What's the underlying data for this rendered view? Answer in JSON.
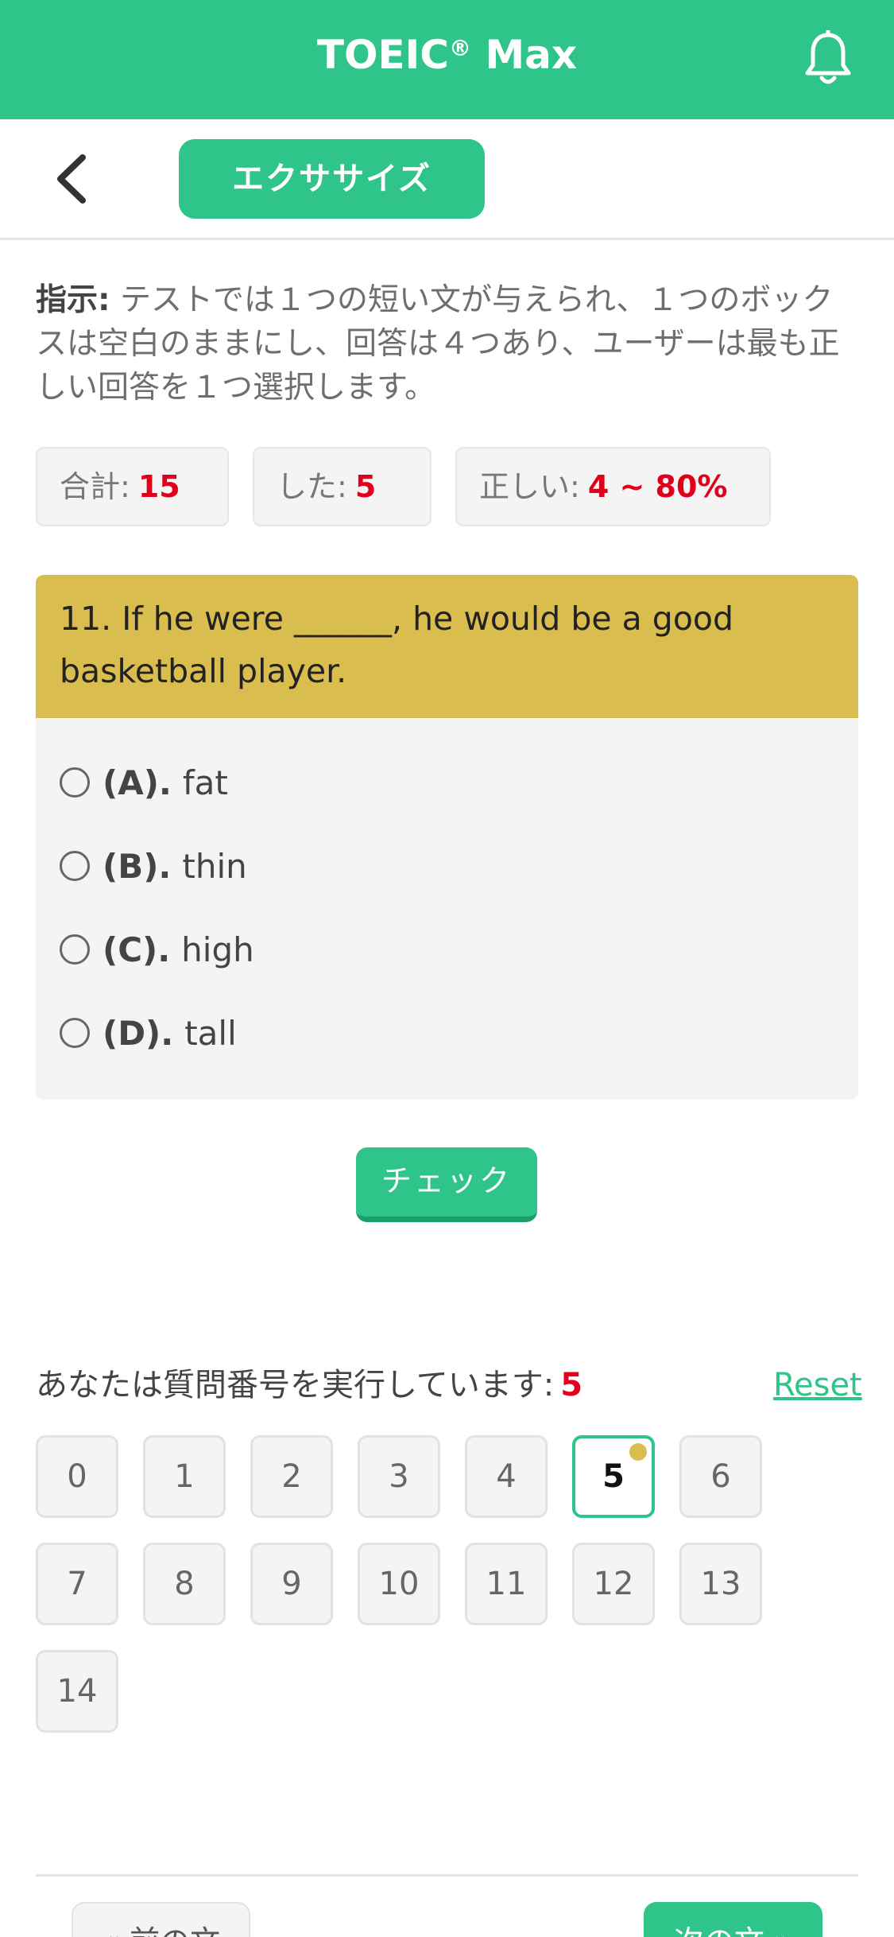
{
  "header": {
    "app_title": "TOEIC",
    "title_mark": "®",
    "title_suffix": " Max",
    "bell_icon": "bell-icon"
  },
  "subheader": {
    "back_icon": "chevron-left-icon",
    "tab_label": "エクササイズ"
  },
  "instructions": {
    "label": "指示:",
    "text": " テストでは１つの短い文が与えられ、１つのボックスは空白のままにし、回答は４つあり、ユーザーは最も正しい回答を１つ選択します。"
  },
  "stats": {
    "total_label": "合計:",
    "total_value": "15",
    "done_label": "した:",
    "done_value": "5",
    "correct_label": "正しい:",
    "correct_value": "4 ~ 80%"
  },
  "question": {
    "text": "11. If he were ______, he would be a good basketball player.",
    "options": [
      {
        "key": "(A).",
        "text": "fat"
      },
      {
        "key": "(B).",
        "text": "thin"
      },
      {
        "key": "(C).",
        "text": "high"
      },
      {
        "key": "(D).",
        "text": "tall"
      }
    ]
  },
  "check_label": "チェック",
  "navigator": {
    "running_label": "あなたは質問番号を実行しています:",
    "current": "5",
    "reset_label": "Reset",
    "numbers": [
      "0",
      "1",
      "2",
      "3",
      "4",
      "5",
      "6",
      "7",
      "8",
      "9",
      "10",
      "11",
      "12",
      "13",
      "14"
    ]
  },
  "footer": {
    "prev_label": "« 前の文",
    "next_label": "次の文 »"
  },
  "colors": {
    "brand_green": "#2ec48a",
    "question_gold": "#dabd4f",
    "value_red": "#e0001b"
  }
}
